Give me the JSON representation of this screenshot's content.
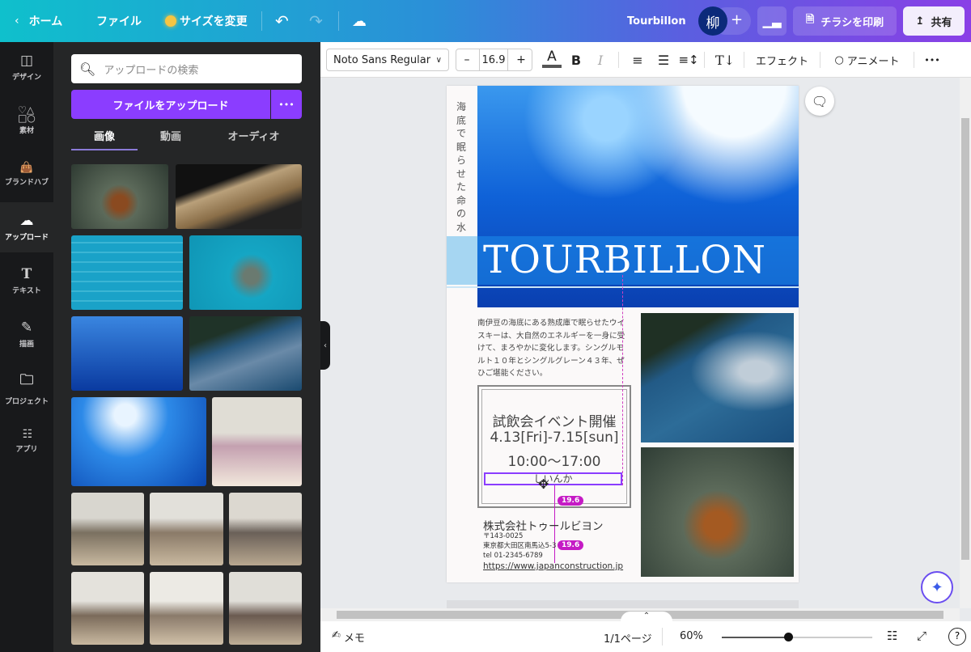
{
  "topbar": {
    "home": "ホーム",
    "file": "ファイル",
    "resize": "サイズを変更",
    "doc_title": "Tourbillon",
    "avatar": "柳",
    "add": "+",
    "print": "チラシを印刷",
    "share": "共有"
  },
  "rail": [
    {
      "label": "デザイン",
      "icon": "layout-icon"
    },
    {
      "label": "素材",
      "icon": "elements-icon"
    },
    {
      "label": "ブランドハブ",
      "icon": "brand-icon"
    },
    {
      "label": "アップロード",
      "icon": "upload-cloud-icon"
    },
    {
      "label": "テキスト",
      "icon": "text-icon"
    },
    {
      "label": "描画",
      "icon": "draw-icon"
    },
    {
      "label": "プロジェクト",
      "icon": "folder-icon"
    },
    {
      "label": "アプリ",
      "icon": "apps-icon"
    }
  ],
  "panel": {
    "search_placeholder": "アップロードの検索",
    "upload_button": "ファイルをアップロード",
    "more": "•••",
    "tabs": [
      "画像",
      "動画",
      "オーディオ"
    ]
  },
  "toolbar": {
    "font": "Noto Sans Regular",
    "minus": "–",
    "size": "16.9",
    "plus": "+",
    "bold": "B",
    "italic": "I",
    "effects": "エフェクト",
    "animate": "アニメート",
    "more": "•••"
  },
  "flyer": {
    "vertical": "海底で眠らせた命の水",
    "title": "TOURBILLON",
    "body": "南伊豆の海底にある熟成庫で眠らせたウイスキーは、大自然のエネルギーを一身に受けて、まろやかに変化します。シングルモルト１０年とシングルグレーン４３年、ぜひご堪能ください。",
    "event_title": "試飲会イベント開催",
    "event_dates": "4.13[Fri]-7.15[sun]",
    "event_time": "10:00〜17:00",
    "selected_text": "しいんか",
    "badge1": "19.6",
    "badge2": "19.6",
    "company": "株式会社トゥールビヨン",
    "zip": "〒143-0025",
    "address": "東京都大田区南馬込5-3",
    "tel": "tel 01-2345-6789",
    "url": "https://www.japanconstruction.jp"
  },
  "bottom": {
    "notes": "メモ",
    "pages": "1/1ページ",
    "zoom": "60%",
    "zoom_fraction": 0.6
  }
}
